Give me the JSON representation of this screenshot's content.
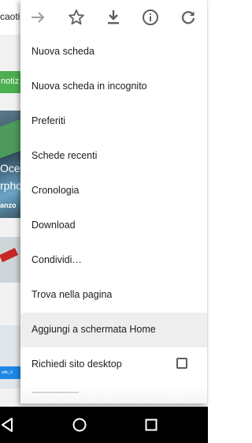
{
  "background_page": {
    "url_fragment": "caoti",
    "badge_text": "notiz",
    "headline_line1": "Oce",
    "headline_line2": "rpho",
    "author_fragment": "anzo",
    "tag_text": "wfic_il"
  },
  "toolbar": {
    "icons": [
      "forward-arrow-icon",
      "star-icon",
      "download-icon",
      "info-icon",
      "refresh-icon"
    ]
  },
  "menu": {
    "items": [
      {
        "label": "Nuova scheda"
      },
      {
        "label": "Nuova scheda in incognito"
      },
      {
        "label": "Preferiti"
      },
      {
        "label": "Schede recenti"
      },
      {
        "label": "Cronologia"
      },
      {
        "label": "Download"
      },
      {
        "label": "Condividi…"
      },
      {
        "label": "Trova nella pagina"
      },
      {
        "label": "Aggiungi a schermata Home"
      },
      {
        "label": "Richiedi sito desktop",
        "checkbox": false
      }
    ],
    "highlighted_item": "Aggiungi a schermata Home"
  },
  "navbar": {
    "icons": [
      "back-triangle-icon",
      "home-circle-icon",
      "recents-square-icon"
    ]
  },
  "colors": {
    "menu_bg": "#ffffff",
    "highlight_bg": "#eeeeee",
    "icon_gray": "#5f5f5f",
    "navbar_bg": "#000000",
    "badge_green": "#4caf50"
  }
}
